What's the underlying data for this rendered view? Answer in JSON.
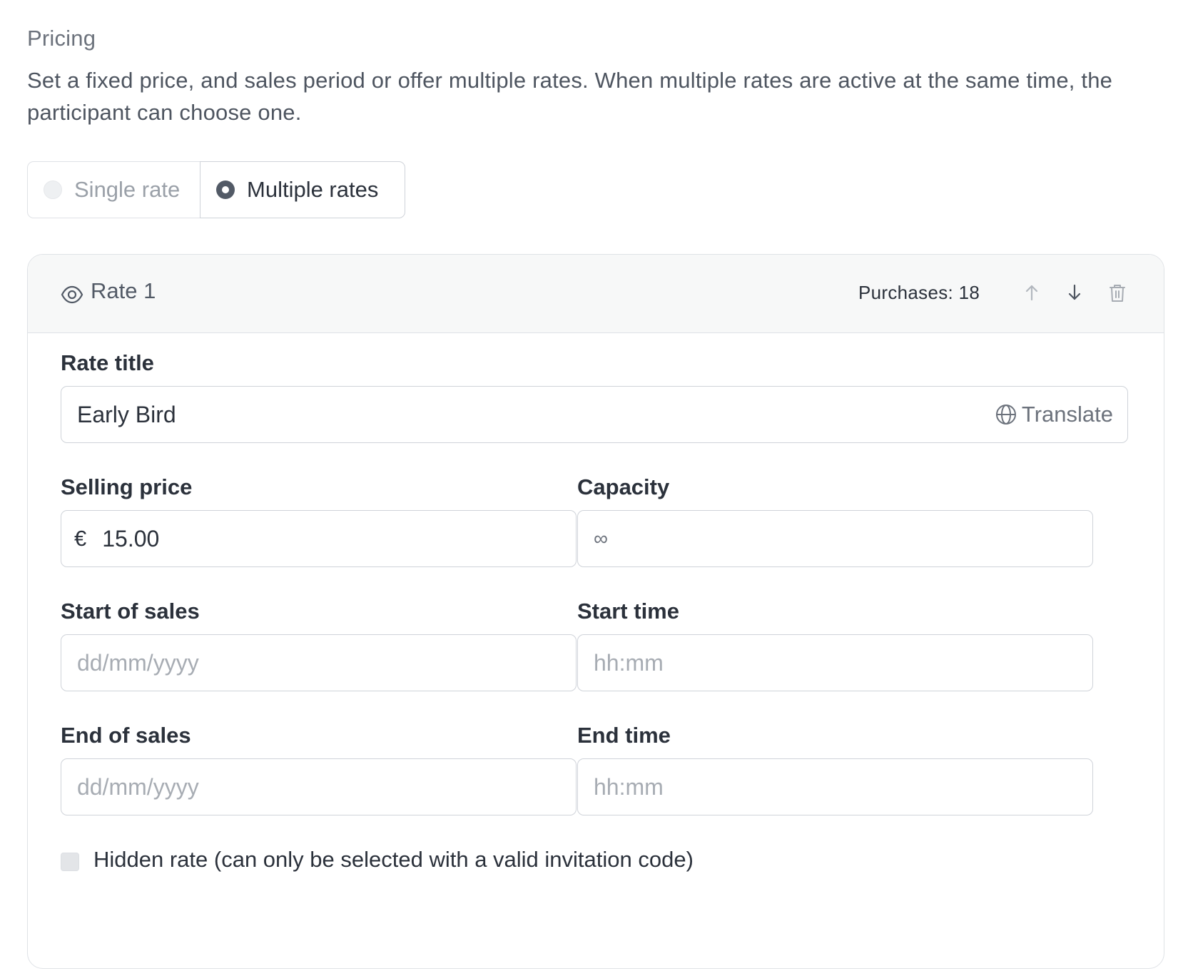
{
  "pricing": {
    "title": "Pricing",
    "description": "Set a fixed price, and sales period or offer multiple rates. When multiple rates are active at the same time, the participant can choose one."
  },
  "rate_mode": {
    "options": [
      {
        "label": "Single rate",
        "selected": false
      },
      {
        "label": "Multiple rates",
        "selected": true
      }
    ]
  },
  "rate": {
    "name": "Rate 1",
    "purchases": "Purchases: 18",
    "icons": {
      "visibility": "eye-icon",
      "move_up": "arrow-up-icon",
      "move_down": "arrow-down-icon",
      "delete": "trash-icon",
      "translate": "globe-icon"
    },
    "title_field": {
      "label": "Rate title",
      "value": "Early Bird",
      "translate_label": "Translate"
    },
    "price_field": {
      "label": "Selling price",
      "currency": "€",
      "value": "15.00"
    },
    "capacity_field": {
      "label": "Capacity",
      "value": "∞"
    },
    "start_date_field": {
      "label": "Start of sales",
      "placeholder": "dd/mm/yyyy"
    },
    "start_time_field": {
      "label": "Start time",
      "placeholder": "hh:mm"
    },
    "end_date_field": {
      "label": "End of sales",
      "placeholder": "dd/mm/yyyy"
    },
    "end_time_field": {
      "label": "End time",
      "placeholder": "hh:mm"
    },
    "hidden_rate": {
      "label": "Hidden rate (can only be selected with a valid invitation code)",
      "checked": false
    }
  },
  "colors": {
    "text": "#2b313b",
    "muted": "#6c727c",
    "border": "#cfd3d9",
    "header_bg": "#f7f8f8",
    "radio_selected": "#525a66"
  }
}
